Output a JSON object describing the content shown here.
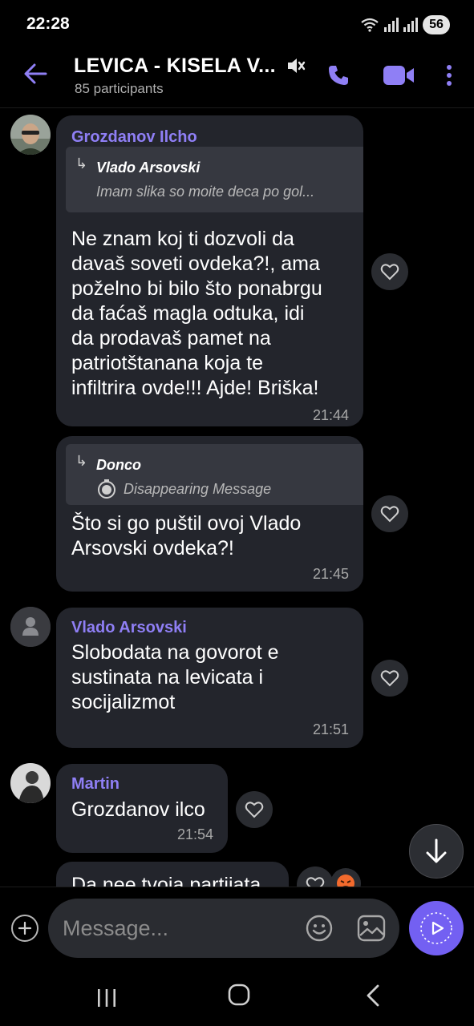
{
  "status_bar": {
    "time": "22:28",
    "battery": "56"
  },
  "header": {
    "title": "LEVICA - KISELA V...",
    "subtitle": "85 participants"
  },
  "messages": [
    {
      "sender": "Grozdanov Ilcho",
      "quote_name": "Vlado Arsovski",
      "quote_text": "Imam slika so moite deca po gol...",
      "text": "Ne znam koj ti dozvoli da\ndavaš soveti ovdeka?!, ama\npoželno bi bilo što ponabrgu\nda fаćaš magla odtuka, idi\nda prodavaš pamet na\npatriotštanana koja te\ninfiltrira ovde!!! Ajde! Briška!",
      "time": "21:44"
    },
    {
      "quote_name": "Donco",
      "quote_text": "Disappearing Message",
      "text": "Što si go puštil ovoj Vlado\nArsovski ovdeka?!",
      "time": "21:45"
    },
    {
      "sender": "Vlado Arsovski",
      "text": "Slobodata na govorot e\nsustinata na levicata i\nsocijalizmot",
      "time": "21:51"
    },
    {
      "sender": "Martin",
      "text": "Grozdanov ilco",
      "time": "21:54"
    },
    {
      "text": "Da nee tvoja partijata"
    }
  ],
  "composer": {
    "placeholder": "Message..."
  },
  "colors": {
    "accent": "#7360f2",
    "sender_name": "#8f7ff5",
    "bubble": "#23252c",
    "background": "#000000"
  },
  "icons": [
    "back-arrow-icon",
    "mute-icon",
    "phone-icon",
    "video-icon",
    "more-icon",
    "heart-icon",
    "timer-icon",
    "arrow-down-icon",
    "plus-icon",
    "emoji-icon",
    "gallery-icon",
    "send-icon"
  ]
}
